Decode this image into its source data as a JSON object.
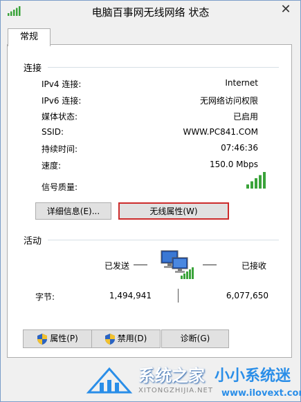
{
  "window": {
    "title": "电脑百事网无线网络 状态",
    "close_label": "✕"
  },
  "tabs": [
    {
      "label": "常规",
      "active": true
    }
  ],
  "connection": {
    "section_title": "连接",
    "rows": [
      {
        "label": "IPv4 连接:",
        "value": "Internet"
      },
      {
        "label": "IPv6 连接:",
        "value": "无网络访问权限"
      },
      {
        "label": "媒体状态:",
        "value": "已启用"
      },
      {
        "label": "SSID:",
        "value": "WWW.PC841.COM"
      },
      {
        "label": "持续时间:",
        "value": "07:46:36"
      },
      {
        "label": "速度:",
        "value": "150.0 Mbps"
      },
      {
        "label": "信号质量:",
        "signal_bars": 5
      }
    ],
    "details_button": "详细信息(E)...",
    "wireless_props_button": "无线属性(W)"
  },
  "activity": {
    "section_title": "活动",
    "sent_label": "已发送",
    "received_label": "已接收",
    "bytes_label": "字节:",
    "bytes_sent": "1,494,941",
    "bytes_received": "6,077,650"
  },
  "bottom_buttons": {
    "properties": "属性(P)",
    "disable": "禁用(D)",
    "diagnose": "诊断(G)"
  },
  "watermark": {
    "main": "系统之家",
    "sub": "XITONGZHIJIA.NET",
    "right": "小小系统迷",
    "url": "www.ilovext.com"
  },
  "colors": {
    "signal": "#3aa33a",
    "focus_border": "#cc2b2b",
    "accent_blue": "#2a8ee8"
  }
}
